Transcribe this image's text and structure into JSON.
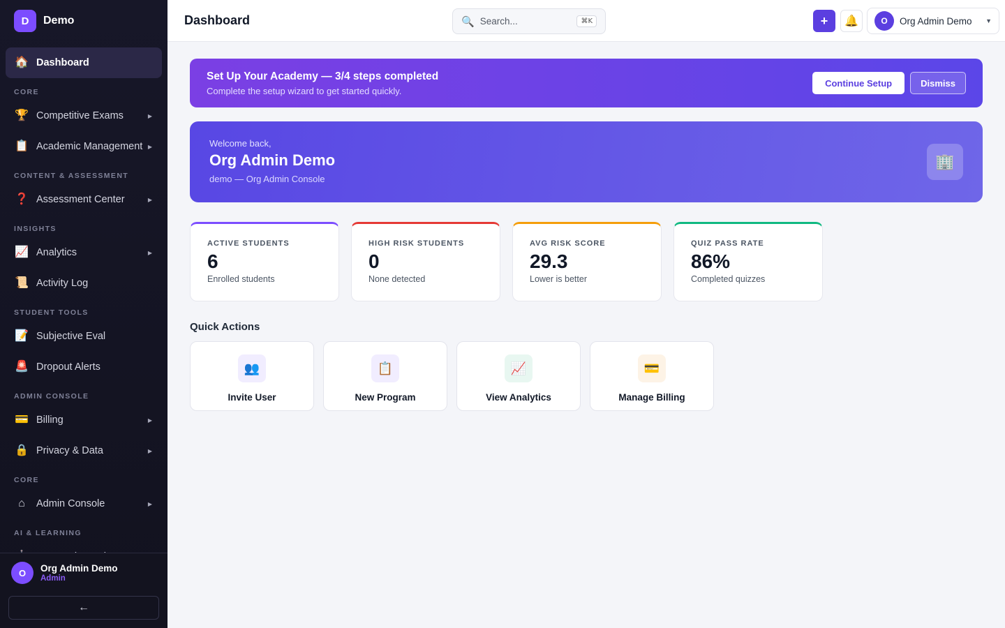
{
  "brand": {
    "logo_letter": "D",
    "name": "Demo"
  },
  "sidebar": {
    "items": [
      {
        "type": "item",
        "icon": "🏠",
        "icon_name": "house-icon",
        "label": "Dashboard",
        "active": true,
        "caret": false
      },
      {
        "type": "section",
        "label": "CORE"
      },
      {
        "type": "item",
        "icon": "🏆",
        "icon_name": "trophy-icon",
        "label": "Competitive Exams",
        "caret": true
      },
      {
        "type": "item",
        "icon": "📋",
        "icon_name": "clipboard-icon",
        "label": "Academic Management",
        "caret": true
      },
      {
        "type": "section",
        "label": "CONTENT & ASSESSMENT"
      },
      {
        "type": "item",
        "icon": "❓",
        "icon_name": "question-mark-icon",
        "label": "Assessment Center",
        "caret": true
      },
      {
        "type": "section",
        "label": "INSIGHTS"
      },
      {
        "type": "item",
        "icon": "📈",
        "icon_name": "chart-icon",
        "label": "Analytics",
        "caret": true
      },
      {
        "type": "item",
        "icon": "📜",
        "icon_name": "scroll-icon",
        "label": "Activity Log",
        "caret": false
      },
      {
        "type": "section",
        "label": "STUDENT TOOLS"
      },
      {
        "type": "item",
        "icon": "📝",
        "icon_name": "memo-icon",
        "label": "Subjective Eval",
        "caret": false
      },
      {
        "type": "item",
        "icon": "🚨",
        "icon_name": "siren-icon",
        "label": "Dropout Alerts",
        "caret": false
      },
      {
        "type": "section",
        "label": "ADMIN CONSOLE"
      },
      {
        "type": "item",
        "icon": "💳",
        "icon_name": "credit-card-icon",
        "label": "Billing",
        "caret": true
      },
      {
        "type": "item",
        "icon": "🔒",
        "icon_name": "lock-icon",
        "label": "Privacy & Data",
        "caret": true
      },
      {
        "type": "section",
        "label": "CORE"
      },
      {
        "type": "item",
        "icon": "⌂",
        "icon_name": "home-outline-icon",
        "label": "Admin Console",
        "caret": true
      },
      {
        "type": "section",
        "label": "AI & LEARNING"
      },
      {
        "type": "item",
        "icon": "🤖",
        "icon_name": "robot-icon",
        "label": "AI Learning Hub",
        "caret": true
      }
    ],
    "footer": {
      "avatar_letter": "O",
      "name": "Org Admin Demo",
      "role": "Admin",
      "collapse_glyph": "←"
    }
  },
  "header": {
    "title": "Dashboard",
    "search": {
      "placeholder": "Search...",
      "shortcut": "⌘K"
    },
    "add_glyph": "+",
    "bell_glyph": "🔔",
    "user": {
      "avatar_letter": "O",
      "name": "Org Admin Demo",
      "caret": "▼"
    }
  },
  "setup_banner": {
    "title": "Set Up Your Academy — 3/4 steps completed",
    "subtitle": "Complete the setup wizard to get started quickly.",
    "continue_label": "Continue Setup",
    "dismiss_label": "Dismiss"
  },
  "welcome": {
    "greeting": "Welcome back,",
    "name": "Org Admin Demo",
    "subtitle": "demo — Org Admin Console",
    "badge_glyph": "🏢"
  },
  "stats": [
    {
      "label": "ACTIVE STUDENTS",
      "value": "6",
      "sub": "Enrolled students",
      "color": "#7c4dff"
    },
    {
      "label": "HIGH RISK STUDENTS",
      "value": "0",
      "sub": "None detected",
      "color": "#e53935"
    },
    {
      "label": "AVG RISK SCORE",
      "value": "29.3",
      "sub": "Lower is better",
      "color": "#f59e0b"
    },
    {
      "label": "QUIZ PASS RATE",
      "value": "86%",
      "sub": "Completed quizzes",
      "color": "#10b981"
    }
  ],
  "quick_actions": {
    "title": "Quick Actions",
    "items": [
      {
        "label": "Invite User",
        "icon": "👥",
        "icon_name": "users-icon",
        "bg": "#f1edff"
      },
      {
        "label": "New Program",
        "icon": "📋",
        "icon_name": "clipboard-icon",
        "bg": "#f1edff"
      },
      {
        "label": "View Analytics",
        "icon": "📈",
        "icon_name": "chart-icon",
        "bg": "#e8f7f1"
      },
      {
        "label": "Manage Billing",
        "icon": "💳",
        "icon_name": "credit-card-icon",
        "bg": "#fdf3e6"
      }
    ]
  }
}
